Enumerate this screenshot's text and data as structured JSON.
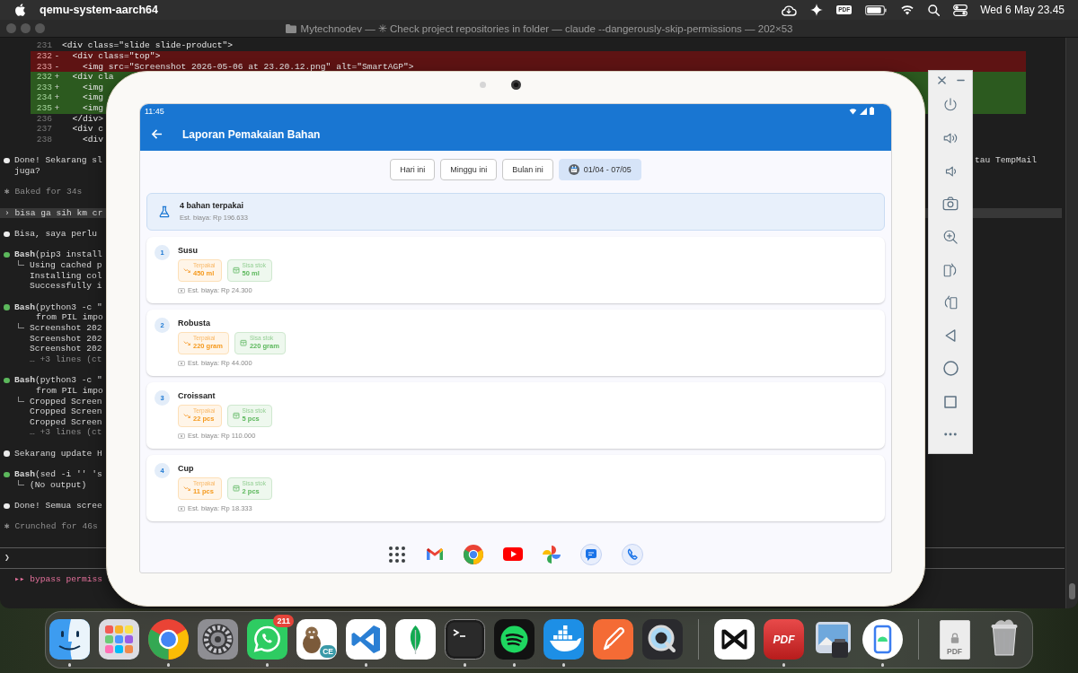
{
  "menu_bar": {
    "app_name": "qemu-system-aarch64",
    "status_items": [
      {
        "kind": "backup"
      },
      {
        "kind": "sparkle"
      },
      {
        "kind": "pdf",
        "text": "PDF"
      },
      {
        "kind": "battery"
      },
      {
        "kind": "wifi"
      },
      {
        "kind": "search"
      },
      {
        "kind": "control-center"
      }
    ],
    "clock": "Wed 6 May 23.45"
  },
  "terminal": {
    "title": "Mytechnodev — ✳ Check project repositories in folder — claude --dangerously-skip-permissions — 202×53",
    "diff": [
      {
        "number": "231",
        "kind": "context",
        "code": "<div class=\"slide slide-product\">"
      },
      {
        "number": "232",
        "kind": "removed",
        "sign": "-",
        "code": "  <div class=\"top\">"
      },
      {
        "number": "233",
        "kind": "removed",
        "sign": "-",
        "code": "    <img src=\"Screenshot 2026-05-06 at 23.20.12.png\" alt=\"SmartAGP\">"
      },
      {
        "number": "232",
        "kind": "added",
        "sign": "+",
        "code": "  <div cla"
      },
      {
        "number": "233",
        "kind": "added",
        "sign": "+",
        "code": "    <img"
      },
      {
        "number": "234",
        "kind": "added",
        "sign": "+",
        "code": "    <img"
      },
      {
        "number": "235",
        "kind": "added",
        "sign": "+",
        "code": "    <img"
      },
      {
        "number": "236",
        "kind": "context",
        "code": "  </div>"
      },
      {
        "number": "237",
        "kind": "context",
        "code": "  <div c"
      },
      {
        "number": "238",
        "kind": "context",
        "code": "    <div"
      }
    ],
    "blocks": [
      {
        "kind": "message",
        "lines": [
          {
            "text": "Done! Sekarang sl",
            "right_text": "tau TempMail"
          },
          {
            "text": "juga?"
          }
        ]
      },
      {
        "kind": "status",
        "lines": [
          {
            "text": "✱ Baked for 34s"
          }
        ]
      },
      {
        "kind": "user",
        "lines": [
          {
            "text": "› bisa ga sih km cr"
          }
        ]
      },
      {
        "kind": "message",
        "lines": [
          {
            "text": "Bisa, saya perlu"
          }
        ]
      },
      {
        "kind": "tool",
        "lines": [
          {
            "text": "**Bash**(pip3 install"
          }
        ],
        "output": [
          {
            "text": "Using cached p",
            "muted": false
          },
          {
            "text": "Installing col",
            "muted": false
          },
          {
            "text": "Successfully i",
            "muted": false
          }
        ]
      },
      {
        "kind": "tool",
        "lines": [
          {
            "text": "**Bash**(python3 -c \""
          },
          {
            "text": "from PIL impo"
          }
        ],
        "output": [
          {
            "text": "Screenshot 202",
            "muted": false
          },
          {
            "text": "Screenshot 202",
            "muted": false
          },
          {
            "text": "Screenshot 202",
            "muted": false
          },
          {
            "text": "… +3 lines (ct",
            "muted": true
          }
        ]
      },
      {
        "kind": "tool",
        "lines": [
          {
            "text": "**Bash**(python3 -c \""
          },
          {
            "text": "from PIL impo"
          }
        ],
        "output": [
          {
            "text": "Cropped Screen",
            "muted": false
          },
          {
            "text": "Cropped Screen",
            "muted": false
          },
          {
            "text": "Cropped Screen",
            "muted": false
          },
          {
            "text": "… +3 lines (ct",
            "muted": true
          }
        ]
      },
      {
        "kind": "message",
        "lines": [
          {
            "text": "Sekarang update H"
          }
        ]
      },
      {
        "kind": "tool",
        "lines": [
          {
            "text": "**Bash**(sed -i '' 's"
          }
        ],
        "output": [
          {
            "text": "(No output)",
            "muted": false
          }
        ]
      },
      {
        "kind": "message",
        "lines": [
          {
            "text": "Done! Semua scree"
          }
        ]
      },
      {
        "kind": "status",
        "lines": [
          {
            "text": "✱ Crunched for 46s"
          }
        ]
      }
    ],
    "prompt_symbol": "❯",
    "mode_line": "▸▸ bypass permiss"
  },
  "emulator": {
    "status_bar": {
      "time": "11:45"
    },
    "app_bar": {
      "title": "Laporan Pemakaian Bahan"
    },
    "filters": [
      {
        "kind": "period",
        "label": "Hari ini",
        "selected": false
      },
      {
        "kind": "period",
        "label": "Minggu ini",
        "selected": false
      },
      {
        "kind": "period",
        "label": "Bulan ini",
        "selected": false
      },
      {
        "kind": "date-range",
        "label": "01/04 - 07/05",
        "selected": true
      }
    ],
    "summary": {
      "title": "4 bahan terpakai",
      "subtitle": "Est. biaya: Rp 196.633"
    },
    "materials": [
      {
        "number": "1",
        "name": "Susu",
        "used": {
          "label": "Terpakai",
          "value": "450 ml"
        },
        "stock": {
          "label": "Sisa stok",
          "value": "50 ml"
        },
        "cost": "Est. biaya: Rp 24.300"
      },
      {
        "number": "2",
        "name": "Robusta",
        "used": {
          "label": "Terpakai",
          "value": "220 gram"
        },
        "stock": {
          "label": "Sisa stok",
          "value": "220 gram"
        },
        "cost": "Est. biaya: Rp 44.000"
      },
      {
        "number": "3",
        "name": "Croissant",
        "used": {
          "label": "Terpakai",
          "value": "22 pcs"
        },
        "stock": {
          "label": "Sisa stok",
          "value": "5 pcs"
        },
        "cost": "Est. biaya: Rp 110.000"
      },
      {
        "number": "4",
        "name": "Cup",
        "used": {
          "label": "Terpakai",
          "value": "11 pcs"
        },
        "stock": {
          "label": "Sisa stok",
          "value": "2 pcs"
        },
        "cost": "Est. biaya: Rp 18.333"
      }
    ],
    "launcher": [
      {
        "kind": "apps"
      },
      {
        "kind": "mail"
      },
      {
        "kind": "browser"
      },
      {
        "kind": "video"
      },
      {
        "kind": "photos"
      },
      {
        "kind": "messages"
      },
      {
        "kind": "phone"
      }
    ]
  },
  "emulator_toolbar": {
    "window_buttons": [
      {
        "kind": "close"
      },
      {
        "kind": "minimize"
      }
    ],
    "controls": [
      {
        "kind": "power"
      },
      {
        "kind": "volume-up"
      },
      {
        "kind": "volume-down"
      },
      {
        "kind": "screenshot"
      },
      {
        "kind": "zoom"
      },
      {
        "kind": "rotate-right"
      },
      {
        "kind": "rotate-left"
      },
      {
        "kind": "back"
      },
      {
        "kind": "home"
      },
      {
        "kind": "overview"
      },
      {
        "kind": "more"
      }
    ]
  },
  "dock": {
    "sections": [
      {
        "items": [
          {
            "kind": "finder",
            "running": true
          },
          {
            "kind": "launchpad",
            "running": false
          },
          {
            "kind": "browser",
            "running": true
          },
          {
            "kind": "settings",
            "running": false
          },
          {
            "kind": "chat",
            "running": true,
            "badge": "211"
          },
          {
            "kind": "database",
            "running": false,
            "icon_text": "CE"
          },
          {
            "kind": "code-editor",
            "running": true
          },
          {
            "kind": "leaf",
            "running": false
          },
          {
            "kind": "terminal",
            "running": true
          },
          {
            "kind": "music",
            "running": true
          },
          {
            "kind": "containers",
            "running": true
          },
          {
            "kind": "api-client",
            "running": false
          },
          {
            "kind": "media-player",
            "running": false
          }
        ]
      },
      {
        "items": [
          {
            "kind": "video-editor",
            "running": false
          },
          {
            "kind": "pdf-editor",
            "running": true,
            "icon_text": "PDF"
          },
          {
            "kind": "preview",
            "running": false
          },
          {
            "kind": "emulator",
            "running": true
          }
        ]
      },
      {
        "items": [
          {
            "kind": "pdf-file",
            "running": false,
            "icon_text": "PDF"
          },
          {
            "kind": "trash",
            "running": false
          }
        ]
      }
    ]
  }
}
